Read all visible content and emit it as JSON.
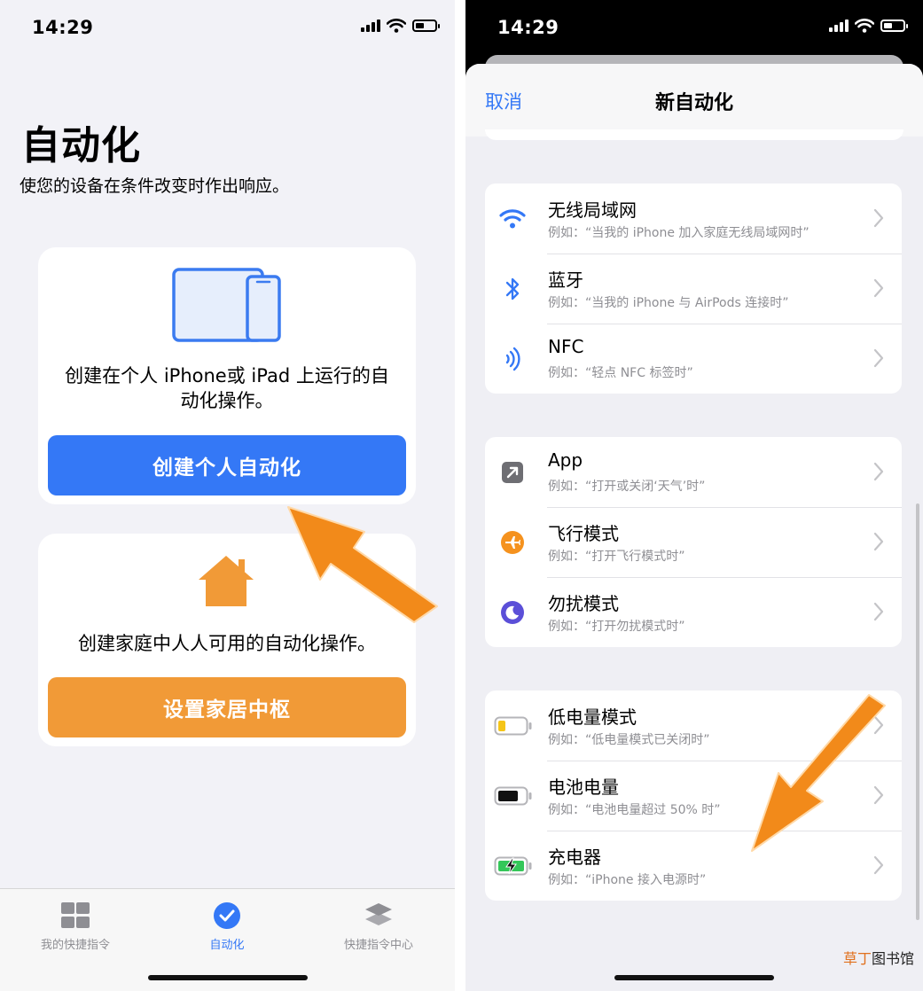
{
  "status_bar": {
    "time": "14:29"
  },
  "left_screen": {
    "title": "自动化",
    "subtitle": "使您的设备在条件改变时作出响应。",
    "personal_card": {
      "icon": "ipad-iphone-icon",
      "text_line1": "创建在个人 iPhone或 iPad 上运行的自",
      "text_line2": "动化操作。",
      "button_label": "创建个人自动化",
      "button_color": "#3478F6"
    },
    "home_card": {
      "icon": "house-icon",
      "text": "创建家庭中人人可用的自动化操作。",
      "button_label": "设置家居中枢",
      "button_color": "#F19A37"
    },
    "tabs": [
      {
        "label": "我的快捷指令",
        "icon": "grid-icon",
        "active": false
      },
      {
        "label": "自动化",
        "icon": "clock-check-icon",
        "active": true
      },
      {
        "label": "快捷指令中心",
        "icon": "layers-icon",
        "active": false
      }
    ]
  },
  "right_screen": {
    "nav": {
      "cancel_label": "取消",
      "title": "新自动化"
    },
    "groups": [
      [
        {
          "title": "无线局域网",
          "subtitle": "例如：“当我的 iPhone 加入家庭无线局域网时”",
          "icon": "wifi-icon"
        },
        {
          "title": "蓝牙",
          "subtitle": "例如：“当我的 iPhone 与 AirPods 连接时”",
          "icon": "bluetooth-icon"
        },
        {
          "title": "NFC",
          "subtitle": "例如：“轻点 NFC 标签时”",
          "icon": "nfc-icon"
        }
      ],
      [
        {
          "title": "App",
          "subtitle": "例如：“打开或关闭‘天气’时”",
          "icon": "app-arrow-icon"
        },
        {
          "title": "飞行模式",
          "subtitle": "例如：“打开飞行模式时”",
          "icon": "airplane-icon"
        },
        {
          "title": "勿扰模式",
          "subtitle": "例如：“打开勿扰模式时”",
          "icon": "moon-icon"
        }
      ],
      [
        {
          "title": "低电量模式",
          "subtitle": "例如：“低电量模式已关闭时”",
          "icon": "low-battery-icon"
        },
        {
          "title": "电池电量",
          "subtitle": "例如：“电池电量超过 50% 时”",
          "icon": "battery-level-icon"
        },
        {
          "title": "充电器",
          "subtitle": "例如：“iPhone 接入电源时”",
          "icon": "charger-icon"
        }
      ]
    ]
  },
  "watermark": {
    "highlight": "草丁",
    "rest": "图书馆"
  },
  "colors": {
    "ios_blue": "#3478F6",
    "ios_orange": "#F19A37",
    "annotation_arrow": "#F28A1A"
  }
}
